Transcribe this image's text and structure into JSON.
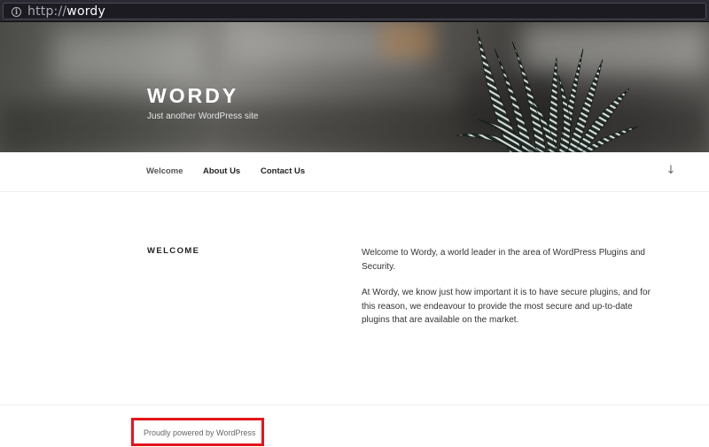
{
  "browser": {
    "url_scheme": "http://",
    "url_host": "wordy",
    "info_icon": "info-icon"
  },
  "header": {
    "site_title": "WORDY",
    "site_description": "Just another WordPress site"
  },
  "nav": {
    "items": [
      {
        "label": "Welcome",
        "current": true
      },
      {
        "label": "About Us",
        "current": false
      },
      {
        "label": "Contact Us",
        "current": false
      }
    ],
    "scroll_icon": "arrow-down-icon"
  },
  "page": {
    "title": "WELCOME",
    "paragraphs": [
      "Welcome to Wordy, a world leader in the area of WordPress Plugins and Security.",
      "At Wordy, we know just how important it is to have secure plugins, and for this reason, we endeavour to provide the most secure and up-to-date plugins that are available on the market."
    ]
  },
  "footer": {
    "powered_by": "Proudly powered by WordPress",
    "highlight_color": "#e4141b"
  }
}
